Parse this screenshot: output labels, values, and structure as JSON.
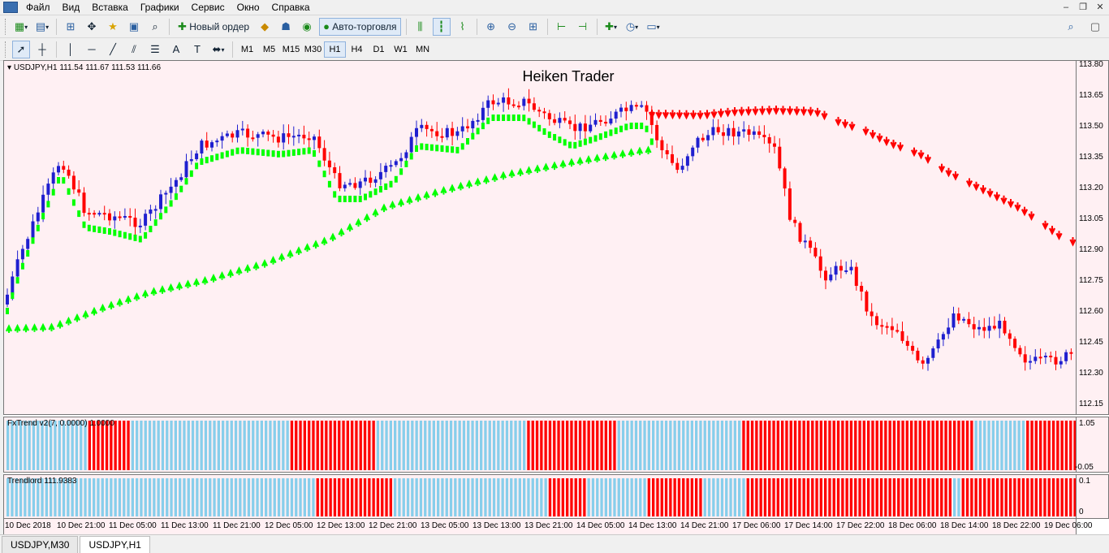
{
  "menu": {
    "items": [
      "Файл",
      "Вид",
      "Вставка",
      "Графики",
      "Сервис",
      "Окно",
      "Справка"
    ]
  },
  "toolbar": {
    "new_order_label": "Новый ордер",
    "auto_trading_label": "Авто-торговля"
  },
  "timeframes": [
    "M1",
    "M5",
    "M15",
    "M30",
    "H1",
    "H4",
    "D1",
    "W1",
    "MN"
  ],
  "active_timeframe": "H1",
  "chart": {
    "symbol_info": "USDJPY,H1  111.54 111.67 111.53 111.66",
    "title": "Heiken Trader",
    "price_axis": [
      "113.80",
      "113.65",
      "113.50",
      "113.35",
      "113.20",
      "113.05",
      "112.90",
      "112.75",
      "112.60",
      "112.45",
      "112.30",
      "112.15"
    ],
    "time_axis": [
      "10 Dec 2018",
      "10 Dec 21:00",
      "11 Dec 05:00",
      "11 Dec 13:00",
      "11 Dec 21:00",
      "12 Dec 05:00",
      "12 Dec 13:00",
      "12 Dec 21:00",
      "13 Dec 05:00",
      "13 Dec 13:00",
      "13 Dec 21:00",
      "14 Dec 05:00",
      "14 Dec 13:00",
      "14 Dec 21:00",
      "17 Dec 06:00",
      "17 Dec 14:00",
      "17 Dec 22:00",
      "18 Dec 06:00",
      "18 Dec 14:00",
      "18 Dec 22:00",
      "19 Dec 06:00"
    ],
    "colors": {
      "background": "#fff0f3",
      "bull_candle": "#1f1fcf",
      "bear_candle": "#ff0000",
      "up_arrow": "#00ff00",
      "down_arrow": "#ff0000",
      "trend_up": "#87ceeb",
      "trend_down": "#ff0000"
    }
  },
  "indicators": {
    "fxtrend": {
      "label": "FxTrend v2(7, 0.0000) 1.0000",
      "scale_top": "1.05",
      "scale_bottom": "-0.05"
    },
    "trendlord": {
      "label": "Trendlord 111.9383",
      "scale_top": "0.1",
      "scale_bottom": "0"
    }
  },
  "tabs": [
    "USDJPY,M30",
    "USDJPY,H1"
  ],
  "active_tab": "USDJPY,H1"
}
